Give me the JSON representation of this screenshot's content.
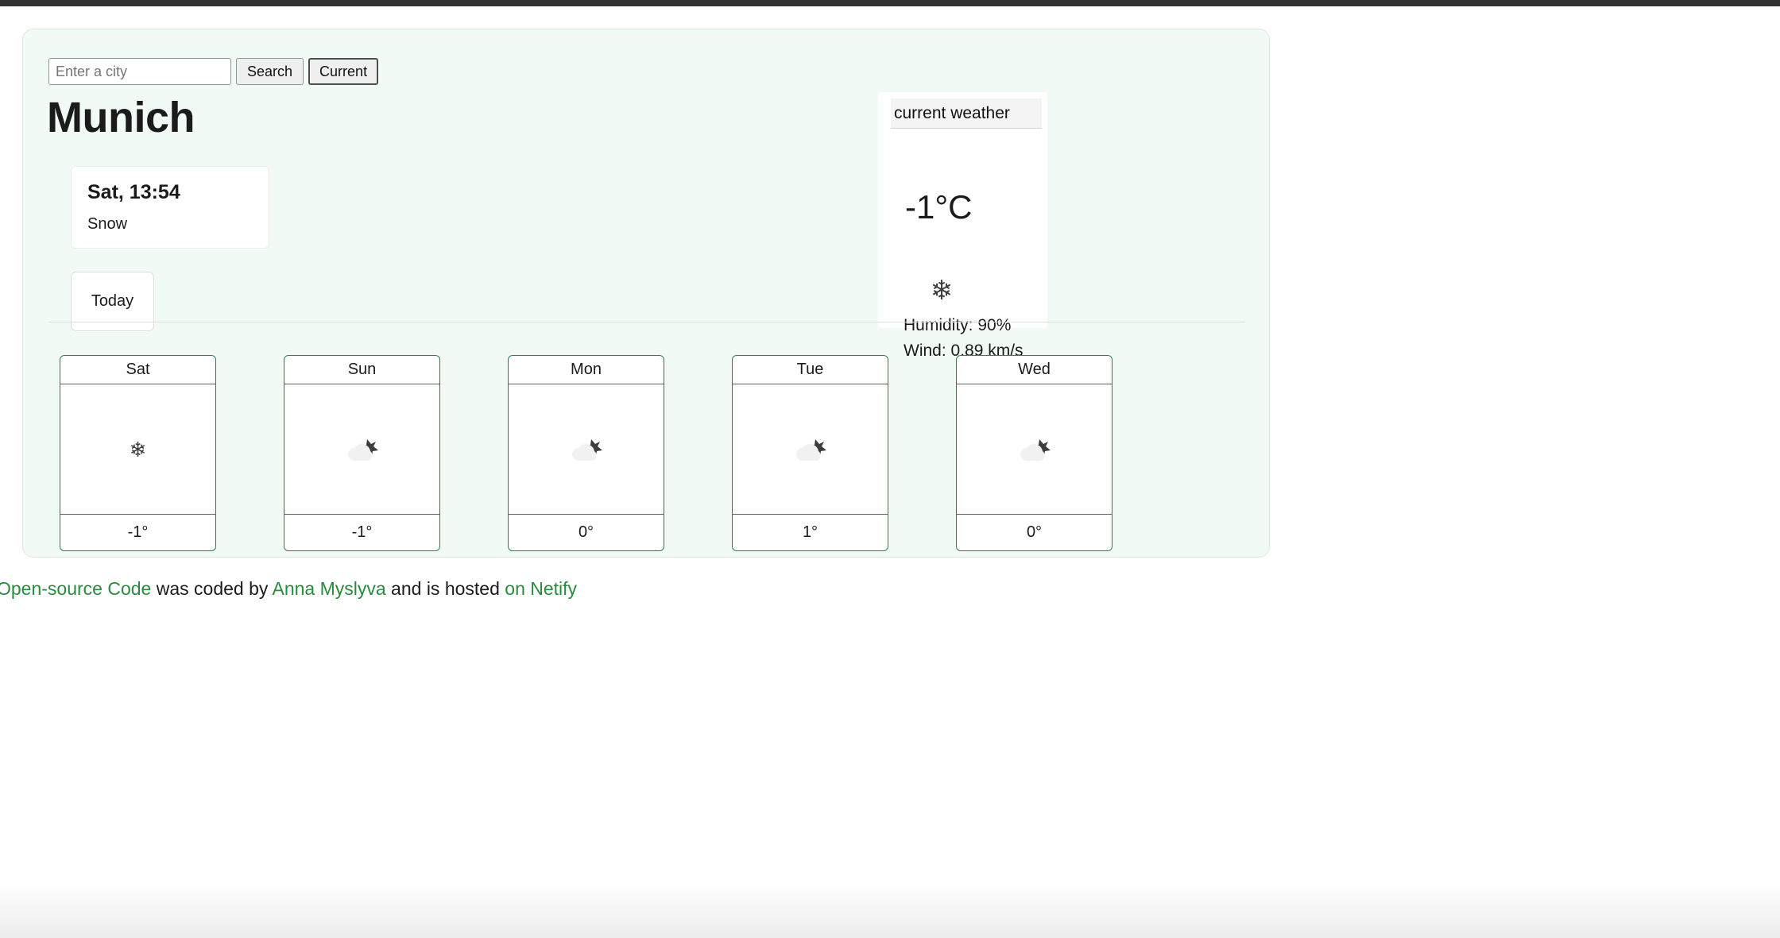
{
  "search": {
    "placeholder": "Enter a city",
    "value": "",
    "search_label": "Search",
    "current_label": "Current"
  },
  "city": "Munich",
  "today_card": {
    "date": "Sat, 13:54",
    "condition": "Snow"
  },
  "today_button": {
    "label": "Today"
  },
  "current_weather": {
    "header": "current weather",
    "temperature": "-1°C",
    "icon": "snowflake-icon",
    "humidity": "Humidity: 90%",
    "wind": "Wind: 0.89 km/s"
  },
  "forecast": [
    {
      "day": "Sat",
      "icon": "snowflake-icon",
      "temp": "-1°"
    },
    {
      "day": "Sun",
      "icon": "cloud-snow-icon",
      "temp": "-1°"
    },
    {
      "day": "Mon",
      "icon": "cloud-snow-icon",
      "temp": "0°"
    },
    {
      "day": "Tue",
      "icon": "cloud-snow-icon",
      "temp": "1°"
    },
    {
      "day": "Wed",
      "icon": "cloud-snow-icon",
      "temp": "0°"
    }
  ],
  "footer": {
    "link_code": "Open-source Code",
    "text_1": " was coded by ",
    "link_author": "Anna Myslyva",
    "text_2": " and is hosted ",
    "link_host": "on Netify"
  },
  "colors": {
    "app_background": "#f1faf4",
    "card_border_green": "#2e7d4f",
    "link_green": "#2a8a3e",
    "icon_dark": "#3d3d3d",
    "cloud_light": "#f1f1f1"
  }
}
